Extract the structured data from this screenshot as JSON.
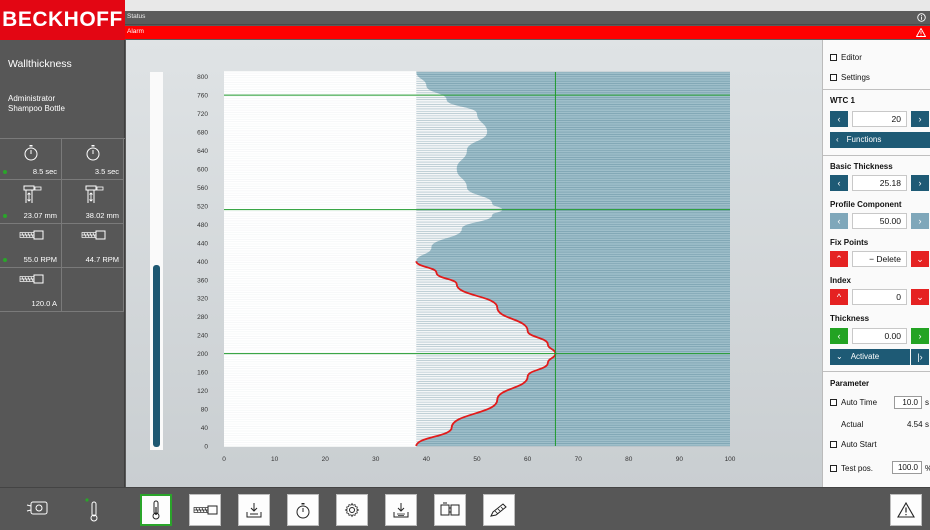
{
  "brand": {
    "logo_text": "BECKHOFF"
  },
  "header": {
    "status_label": "Status",
    "alarm_label": "Alarm"
  },
  "sidebar": {
    "title": "Wallthickness",
    "user_line1": "Administrator",
    "user_line2": "Shampoo Bottle",
    "tiles": [
      {
        "icon": "stopwatch-icon",
        "value": "8.5 sec",
        "indicator": true
      },
      {
        "icon": "stopwatch-icon",
        "value": "3.5 sec",
        "indicator": false
      },
      {
        "icon": "die-gap-icon",
        "value": "23.07 mm",
        "indicator": true
      },
      {
        "icon": "die-gap-icon",
        "value": "38.02 mm",
        "indicator": false
      },
      {
        "icon": "extruder-icon",
        "value": "55.0 RPM",
        "indicator": true
      },
      {
        "icon": "extruder-icon",
        "value": "44.7 RPM",
        "indicator": false
      },
      {
        "icon": "extruder-icon",
        "value": "120.0 A",
        "indicator": false
      }
    ]
  },
  "progress": {
    "level": 0.49
  },
  "chart_data": {
    "type": "line",
    "x_ticks": [
      "0",
      "10",
      "20",
      "30",
      "40",
      "50",
      "60",
      "70",
      "80",
      "90",
      "100"
    ],
    "y_ticks": [
      "0",
      "40",
      "80",
      "120",
      "160",
      "200",
      "240",
      "280",
      "320",
      "360",
      "400",
      "440",
      "480",
      "520",
      "560",
      "600",
      "640",
      "680",
      "720",
      "760",
      "800"
    ],
    "xlim": [
      0,
      100
    ],
    "ylim": [
      0,
      810
    ],
    "base_thickness": 38,
    "cursor_x": 65.5,
    "h_lines": [
      200,
      512,
      760
    ],
    "profile_points": [
      [
        38,
        0
      ],
      [
        45,
        40
      ],
      [
        54,
        100
      ],
      [
        60,
        150
      ],
      [
        64,
        180
      ],
      [
        65.5,
        200
      ],
      [
        64,
        220
      ],
      [
        60,
        250
      ],
      [
        54,
        300
      ],
      [
        46,
        350
      ],
      [
        42,
        375
      ],
      [
        38,
        400
      ],
      [
        41,
        430
      ],
      [
        47,
        470
      ],
      [
        53,
        500
      ],
      [
        55,
        512
      ],
      [
        53,
        525
      ],
      [
        48,
        560
      ],
      [
        46,
        600
      ],
      [
        48,
        640
      ],
      [
        52,
        680
      ],
      [
        50,
        720
      ],
      [
        44,
        750
      ],
      [
        40,
        780
      ],
      [
        38,
        810
      ]
    ],
    "active_max_y": 400,
    "grid": true
  },
  "panel": {
    "editor_label": "Editor",
    "settings_label": "Settings",
    "wtc_label": "WTC 1",
    "wtc_value": "20",
    "functions_label": "Functions",
    "basic_thickness_label": "Basic Thickness",
    "basic_thickness_value": "25.18",
    "profile_component_label": "Profile Component",
    "profile_component_value": "50.00",
    "fix_points_label": "Fix Points",
    "fix_points_value": "− Delete",
    "index_label": "Index",
    "index_value": "0",
    "thickness_label": "Thickness",
    "thickness_value": "0.00",
    "activate_label": "Activate",
    "parameter_label": "Parameter",
    "auto_time_label": "Auto Time",
    "auto_time_value": "10.0",
    "auto_time_unit": "s",
    "actual_label": "Actual",
    "actual_value": "4.54",
    "actual_unit": "s",
    "auto_start_label": "Auto Start",
    "test_pos_label": "Test pos.",
    "test_pos_value": "100.0",
    "test_pos_unit": "%"
  },
  "bottombar": {
    "buttons": [
      "thermometer-icon",
      "extruder-icon",
      "parison-icon",
      "stopwatch-icon",
      "gear-icon",
      "parison-down-icon",
      "mold-icon",
      "pen-icon"
    ]
  }
}
